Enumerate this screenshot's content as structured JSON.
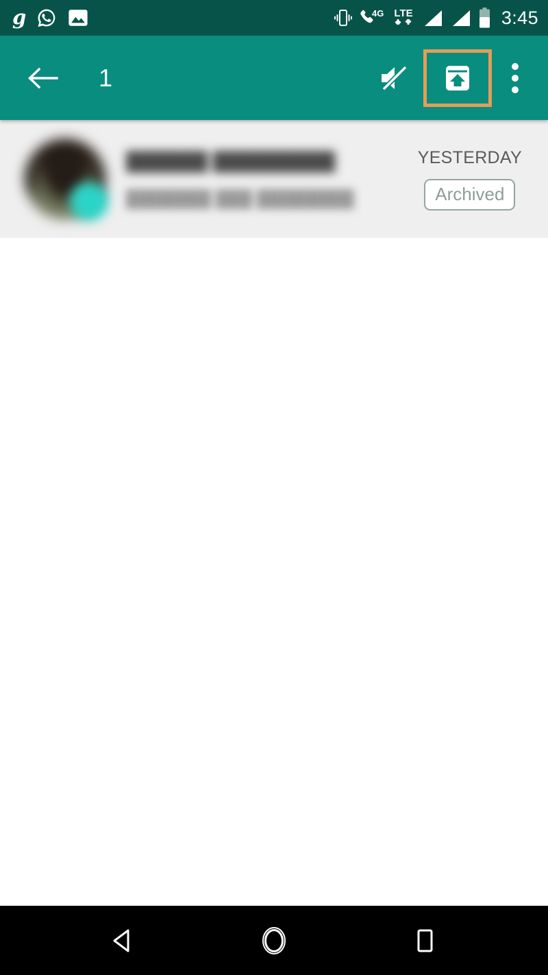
{
  "status_bar": {
    "background_color": "#075349",
    "foreground_color": "#FFFFFF",
    "left_icons": [
      {
        "name": "gaana-app-icon",
        "glyph": "g"
      },
      {
        "name": "whatsapp-notification-icon",
        "glyph": "whatsapp"
      },
      {
        "name": "photo-notification-icon",
        "glyph": "image"
      }
    ],
    "right_icons": [
      {
        "name": "vibrate-mode-icon",
        "glyph": "vibrate"
      },
      {
        "name": "call-4g-icon",
        "glyph": "phone",
        "label": "4G"
      },
      {
        "name": "lte-data-icon",
        "label": "LTE",
        "glyph": "data-arrows"
      },
      {
        "name": "signal-strength-sim1-icon",
        "glyph": "signal"
      },
      {
        "name": "signal-strength-sim2-icon",
        "glyph": "signal"
      },
      {
        "name": "battery-icon",
        "glyph": "battery",
        "level_percent": 50
      }
    ],
    "clock": "3:45"
  },
  "app_bar": {
    "background_color": "#098D7E",
    "back_label": "back",
    "selected_count": "1",
    "highlight_color": "#E79C57",
    "actions": [
      {
        "name": "mute-button",
        "label": "Mute",
        "highlighted": false
      },
      {
        "name": "unarchive-button",
        "label": "Unarchive",
        "highlighted": true
      },
      {
        "name": "overflow-menu-button",
        "label": "More options",
        "highlighted": false
      }
    ]
  },
  "chat_list": {
    "selected_row_color": "#EFEFEF",
    "rows": [
      {
        "name": "██████ █████████",
        "message": "███████ ███ ████████",
        "time": "YESTERDAY",
        "badge": "Archived",
        "selected": true
      }
    ]
  },
  "nav_bar": {
    "background_color": "#000000",
    "buttons": [
      {
        "name": "nav-back-button",
        "label": "Back"
      },
      {
        "name": "nav-home-button",
        "label": "Home"
      },
      {
        "name": "nav-recents-button",
        "label": "Recents"
      }
    ]
  }
}
